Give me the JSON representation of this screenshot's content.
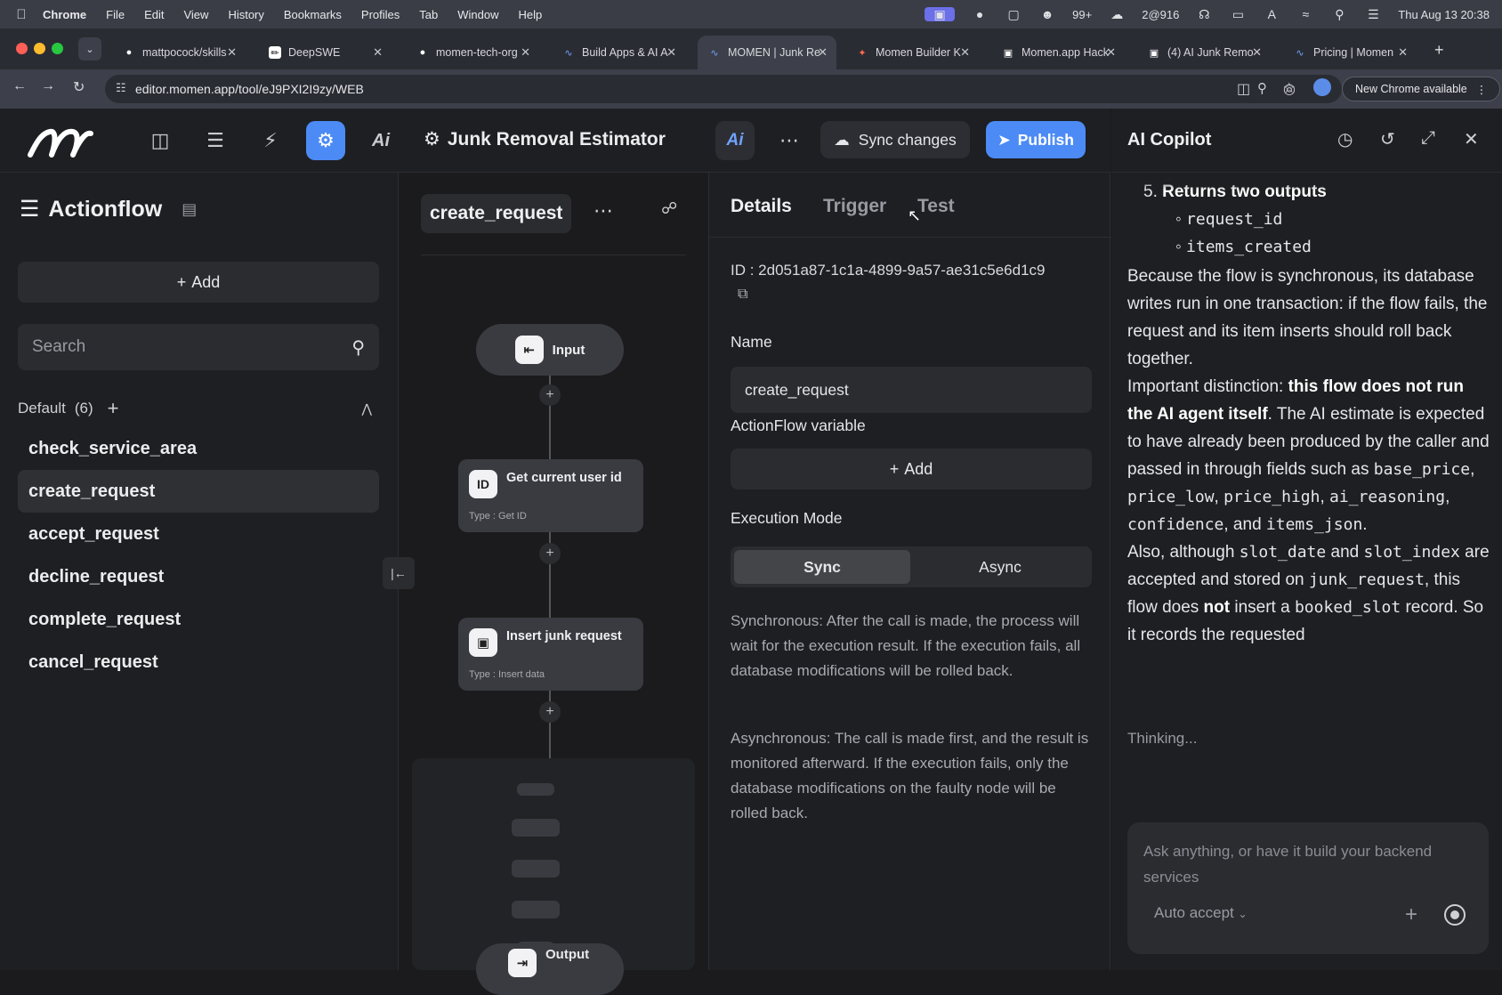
{
  "menubar": {
    "app": "Chrome",
    "items": [
      "File",
      "Edit",
      "View",
      "History",
      "Bookmarks",
      "Profiles",
      "Tab",
      "Window",
      "Help"
    ],
    "status": {
      "wechat_count": "99+",
      "time_label": "2@916",
      "datetime": "Thu Aug 13  20:38"
    }
  },
  "tabs": [
    {
      "title": "mattpocock/skills",
      "active": false
    },
    {
      "title": "DeepSWE",
      "active": false
    },
    {
      "title": "momen-tech-org",
      "active": false
    },
    {
      "title": "Build Apps & AI A",
      "active": false
    },
    {
      "title": "MOMEN | Junk Re",
      "active": true
    },
    {
      "title": "Momen Builder K",
      "active": false
    },
    {
      "title": "Momen.app Hack",
      "active": false
    },
    {
      "title": "(4) AI Junk Remo",
      "active": false
    },
    {
      "title": "Pricing | Momen",
      "active": false
    }
  ],
  "addressbar": {
    "url": "editor.momen.app/tool/eJ9PXI2I9zy/WEB",
    "new_chrome": "New Chrome available"
  },
  "toolbar": {
    "project_title": "Junk Removal Estimator",
    "ai_label": "Ai",
    "sync_label": "Sync changes",
    "publish_label": "Publish"
  },
  "sidebar": {
    "title": "Actionflow",
    "add_label": "Add",
    "search_placeholder": "Search",
    "group_label": "Default",
    "group_count": "(6)",
    "items": [
      "check_service_area",
      "create_request",
      "accept_request",
      "decline_request",
      "complete_request",
      "cancel_request"
    ],
    "selected": "create_request"
  },
  "flow": {
    "name": "create_request",
    "input_node": "Input",
    "nodes": [
      {
        "title": "Get current user id",
        "type": "Type : Get ID",
        "icon": "ID"
      },
      {
        "title": "Insert junk request",
        "type": "Type : Insert data",
        "icon": "db"
      }
    ],
    "output_node": "Output"
  },
  "details": {
    "tabs": [
      "Details",
      "Trigger",
      "Test"
    ],
    "active_tab": "Details",
    "id_text": "ID : 2d051a87-1c1a-4899-9a57-ae31c5e6d1c9",
    "name_label": "Name",
    "name_value": "create_request",
    "variable_label": "ActionFlow variable",
    "add_label": "Add",
    "exec_label": "Execution Mode",
    "modes": [
      "Sync",
      "Async"
    ],
    "selected_mode": "Sync",
    "sync_desc": "Synchronous: After the call is made, the process will wait for the execution result. If the execution fails, all database modifications will be rolled back.",
    "async_desc": "Asynchronous: The call is made first, and the result is monitored afterward. If the execution fails, only the database modifications on the faulty node will be rolled back."
  },
  "copilot": {
    "title": "AI Copilot",
    "list_item_num": "5.",
    "list_item_title": "Returns two outputs",
    "outputs": [
      "request_id",
      "items_created"
    ],
    "para1": "Because the flow is synchronous, its database writes run in one transaction: if the flow fails, the request and its item inserts should roll back together.",
    "para2_lead": "Important distinction: ",
    "para2_bold": "this flow does not run the AI agent itself",
    "para2_rest": ". The AI estimate is expected to have already been produced by the caller and passed in through fields such as ",
    "fields": [
      "base_price",
      "price_low",
      "price_high",
      "ai_reasoning",
      "confidence",
      "items_json"
    ],
    "para3_a": "Also, although ",
    "slot_date": "slot_date",
    "para3_b": " and ",
    "slot_index": "slot_index",
    "para3_c": " are accepted and stored on ",
    "junk_request": "junk_request",
    "para3_d": ", this flow does ",
    "not": "not",
    "para3_e": " insert a ",
    "booked_slot": "booked_slot",
    "para3_f": " record. So it records the requested",
    "thinking": "Thinking...",
    "input_placeholder": "Ask anything, or have it build your backend services",
    "auto_accept": "Auto accept"
  }
}
